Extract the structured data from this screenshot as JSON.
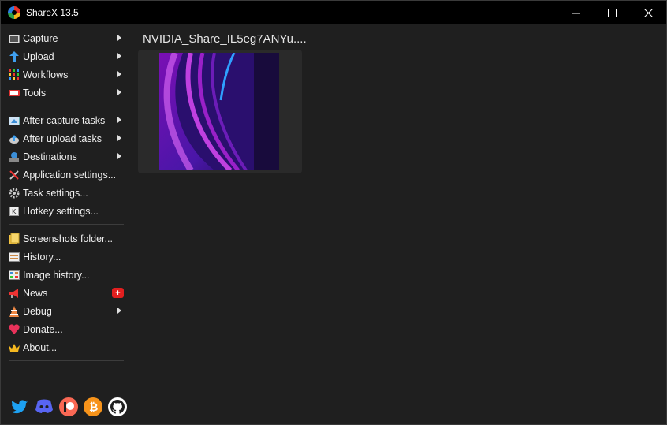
{
  "window": {
    "title": "ShareX 13.5",
    "controls": {
      "minimize": "—",
      "maximize": "☐",
      "close": "✕"
    }
  },
  "sidebar": {
    "groups": [
      [
        {
          "label": "Capture",
          "icon": "capture-icon",
          "submenu": true
        },
        {
          "label": "Upload",
          "icon": "upload-icon",
          "submenu": true
        },
        {
          "label": "Workflows",
          "icon": "workflows-icon",
          "submenu": true
        },
        {
          "label": "Tools",
          "icon": "tools-icon",
          "submenu": true
        }
      ],
      [
        {
          "label": "After capture tasks",
          "icon": "after-capture-icon",
          "submenu": true
        },
        {
          "label": "After upload tasks",
          "icon": "after-upload-icon",
          "submenu": true
        },
        {
          "label": "Destinations",
          "icon": "destinations-icon",
          "submenu": true
        },
        {
          "label": "Application settings...",
          "icon": "wrench-icon",
          "submenu": false
        },
        {
          "label": "Task settings...",
          "icon": "gear-icon",
          "submenu": false
        },
        {
          "label": "Hotkey settings...",
          "icon": "keyboard-icon",
          "submenu": false
        }
      ],
      [
        {
          "label": "Screenshots folder...",
          "icon": "folder-icon",
          "submenu": false
        },
        {
          "label": "History...",
          "icon": "history-icon",
          "submenu": false
        },
        {
          "label": "Image history...",
          "icon": "image-history-icon",
          "submenu": false
        },
        {
          "label": "News",
          "icon": "megaphone-icon",
          "submenu": false,
          "badge": "+"
        },
        {
          "label": "Debug",
          "icon": "debug-icon",
          "submenu": true
        },
        {
          "label": "Donate...",
          "icon": "heart-icon",
          "submenu": false
        },
        {
          "label": "About...",
          "icon": "crown-icon",
          "submenu": false
        }
      ]
    ]
  },
  "social": [
    "twitter-icon",
    "discord-icon",
    "patreon-icon",
    "bitcoin-icon",
    "github-icon"
  ],
  "content": {
    "file_name": "NVIDIA_Share_IL5eg7ANYu...."
  },
  "colors": {
    "titlebar": "#000000",
    "background": "#1f1f1f",
    "accent_red": "#e21f1f"
  }
}
